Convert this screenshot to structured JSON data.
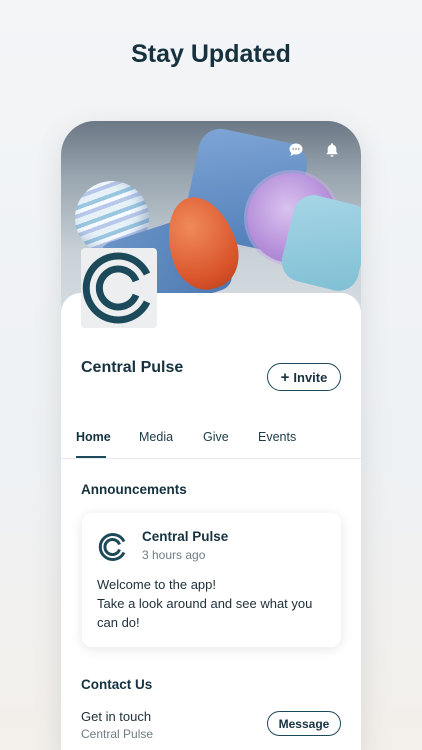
{
  "headline": "Stay Updated",
  "header_icons": [
    "chat-icon",
    "bell-icon"
  ],
  "org": {
    "name": "Central Pulse",
    "invite_label": "Invite"
  },
  "tabs": [
    {
      "label": "Home",
      "active": true
    },
    {
      "label": "Media",
      "active": false
    },
    {
      "label": "Give",
      "active": false
    },
    {
      "label": "Events",
      "active": false
    }
  ],
  "announcements": {
    "title": "Announcements",
    "post": {
      "author": "Central Pulse",
      "time": "3 hours ago",
      "body": "Welcome to the app!\nTake a look around and see what you can do!"
    }
  },
  "contact": {
    "title": "Contact Us",
    "label": "Get in touch",
    "sub": "Central Pulse",
    "button": "Message"
  },
  "colors": {
    "brand": "#1d4a5a",
    "text": "#16323f",
    "muted": "#6e7c84"
  }
}
